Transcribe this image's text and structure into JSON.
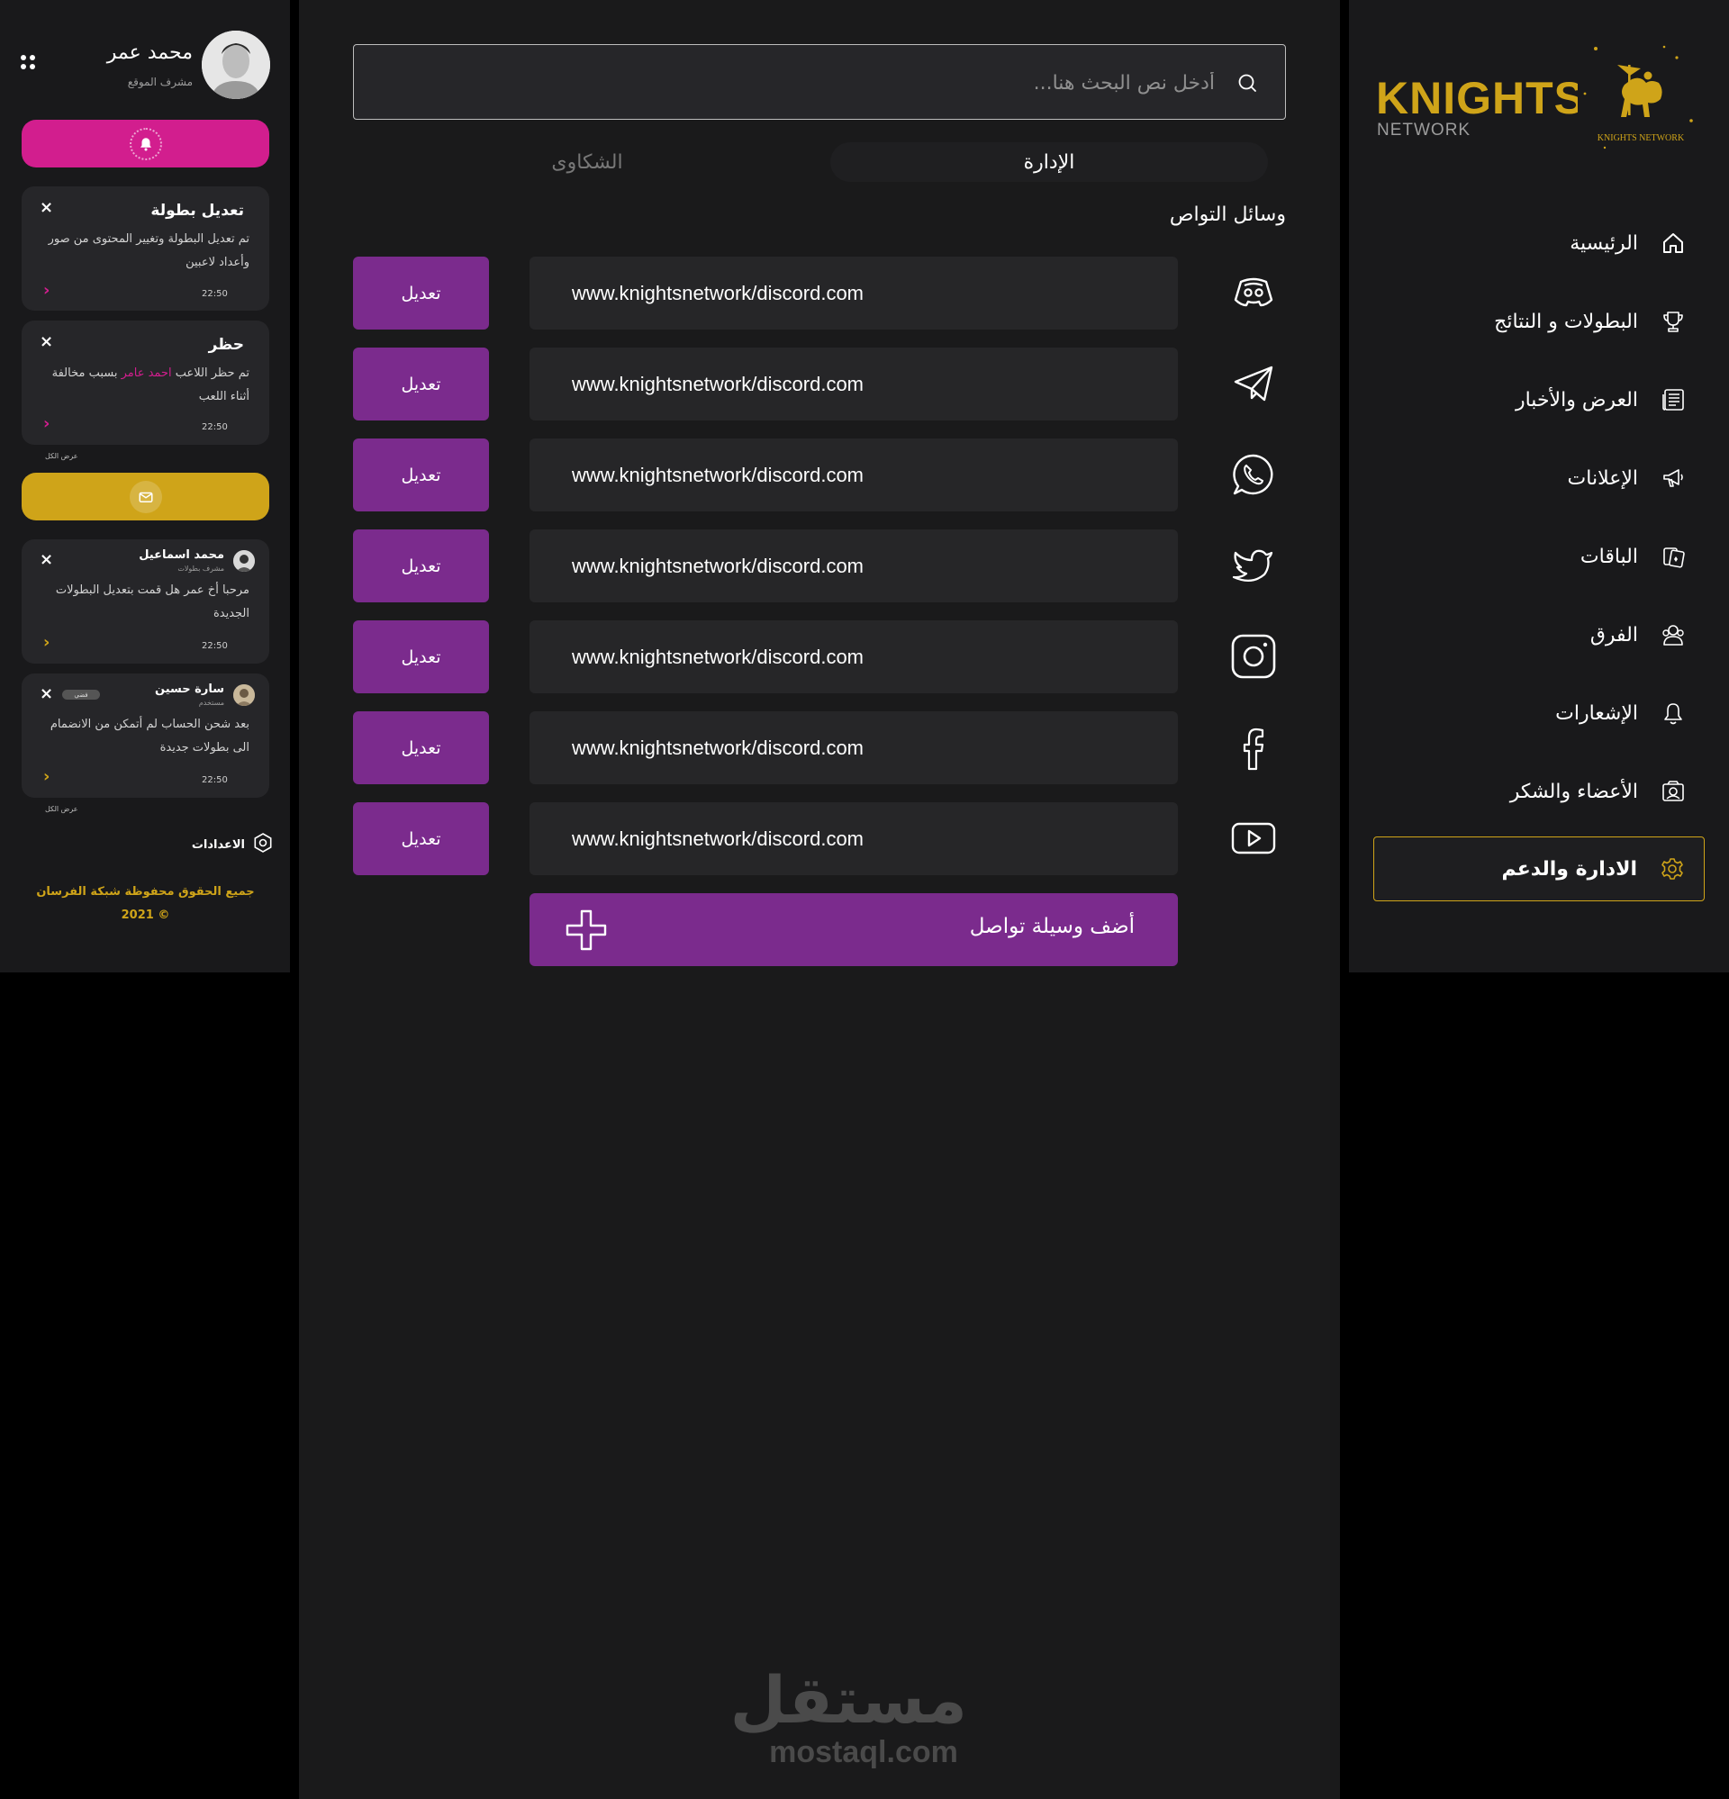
{
  "user": {
    "name": "محمد عمر",
    "role": "مشرف الموقع"
  },
  "notifications": [
    {
      "title": "تعديل بطولة",
      "body": "تم تعديل البطولة وتغيير المحتوى من صور وأعداد لاعبين",
      "time": "22:50"
    },
    {
      "title": "حظر",
      "body_before": "تم حظر اللاعب",
      "highlight": "احمد عامر",
      "body_after": "بسبب مخالفة أثناء اللعب",
      "time": "22:50"
    }
  ],
  "view_all_label": "عرض الكل",
  "messages": [
    {
      "name": "محمد اسماعيل",
      "role": "مشرف بطولات",
      "body": "مرحبا أخ عمر هل قمت بتعديل البطولات الجديدة",
      "time": "22:50"
    },
    {
      "name": "سارة حسين",
      "role": "مستخدم",
      "tag": "فضي",
      "body": "بعد شحن الحساب لم أتمكن من الانضمام الى بطولات جديدة",
      "time": "22:50"
    }
  ],
  "settings_label": "الاعدادات",
  "copyright": {
    "line1": "جميع الحقوق محفوظة شبكة الفرسان",
    "line2": "© 2021"
  },
  "search": {
    "placeholder": "أدخل نص البحث هنا..."
  },
  "tabs": {
    "admin": "الإدارة",
    "complaints": "الشكاوى"
  },
  "section_title": "وسائل التواص",
  "social_links": [
    {
      "icon": "discord-icon",
      "url": "www.knightsnetwork/discord.com",
      "edit_label": "تعديل"
    },
    {
      "icon": "telegram-icon",
      "url": "www.knightsnetwork/discord.com",
      "edit_label": "تعديل"
    },
    {
      "icon": "whatsapp-icon",
      "url": "www.knightsnetwork/discord.com",
      "edit_label": "تعديل"
    },
    {
      "icon": "twitter-icon",
      "url": "www.knightsnetwork/discord.com",
      "edit_label": "تعديل"
    },
    {
      "icon": "instagram-icon",
      "url": "www.knightsnetwork/discord.com",
      "edit_label": "تعديل"
    },
    {
      "icon": "facebook-icon",
      "url": "www.knightsnetwork/discord.com",
      "edit_label": "تعديل"
    },
    {
      "icon": "youtube-icon",
      "url": "www.knightsnetwork/discord.com",
      "edit_label": "تعديل"
    }
  ],
  "add_button_label": "أضف وسيلة تواصل",
  "watermark": {
    "ar": "مستقل",
    "en": "mostaql.com"
  },
  "logo": {
    "title": "KNIGHTS",
    "subtitle": "NETWORK",
    "emblem_text": "KNIGHTS NETWORK"
  },
  "nav": [
    {
      "label": "الرئيسية",
      "icon": "home-icon"
    },
    {
      "label": "البطولات و النتائج",
      "icon": "trophy-icon"
    },
    {
      "label": "العرض والأخبار",
      "icon": "news-icon"
    },
    {
      "label": "الإعلانات",
      "icon": "megaphone-icon"
    },
    {
      "label": "الباقات",
      "icon": "cards-icon"
    },
    {
      "label": "الفرق",
      "icon": "team-icon"
    },
    {
      "label": "الإشعارات",
      "icon": "bell-icon"
    },
    {
      "label": "الأعضاء والشكر",
      "icon": "members-icon"
    },
    {
      "label": "الادارة والدعم",
      "icon": "gear-icon",
      "active": true
    }
  ],
  "colors": {
    "accent_purple": "#7b2b8d",
    "pink": "#d21e8e",
    "gold": "#cfa419",
    "panel": "#19191b"
  }
}
